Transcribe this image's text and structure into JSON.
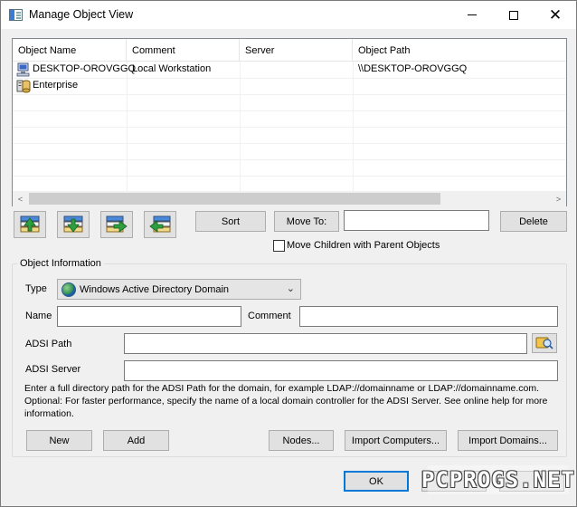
{
  "window": {
    "title": "Manage Object View",
    "minimize_icon": "minimize-icon",
    "maximize_icon": "maximize-icon",
    "close_icon": "close-icon",
    "close_glyph": "✕"
  },
  "list": {
    "columns": [
      "Object Name",
      "Comment",
      "Server",
      "Object Path"
    ],
    "rows": [
      {
        "icon": "workstation-icon",
        "name": "DESKTOP-OROVGGQ",
        "comment": "Local Workstation",
        "server": "",
        "path": "\\\\DESKTOP-OROVGGQ"
      },
      {
        "icon": "enterprise-icon",
        "name": "Enterprise",
        "comment": "",
        "server": "",
        "path": ""
      }
    ],
    "scroll_left_glyph": "<",
    "scroll_right_glyph": ">"
  },
  "toolbar": {
    "move_up_icon": "move-up-icon",
    "move_down_icon": "move-down-icon",
    "move_right_icon": "move-right-icon",
    "move_left_icon": "move-left-icon",
    "sort_label": "Sort",
    "move_to_label": "Move To:",
    "move_to_value": "",
    "delete_label": "Delete",
    "move_children_label": "Move Children with Parent Objects",
    "move_children_checked": false
  },
  "object_info": {
    "group_title": "Object Information",
    "type_label": "Type",
    "type_value": "Windows Active Directory Domain",
    "type_icon": "globe-icon",
    "chevron": "⌄",
    "name_label": "Name",
    "name_value": "",
    "comment_label": "Comment",
    "comment_value": "",
    "adsi_path_label": "ADSI Path",
    "adsi_path_value": "",
    "adsi_server_label": "ADSI Server",
    "adsi_server_value": "",
    "help_text": "Enter a full directory path for the ADSI Path for the domain, for example LDAP://domainname or LDAP://domainname.com.  Optional: For faster performance, specify the name of a local domain controller for the ADSI Server.  See online help for more  information.",
    "new_label": "New",
    "add_label": "Add",
    "nodes_label": "Nodes...",
    "import_computers_label": "Import Computers...",
    "import_domains_label": "Import Domains..."
  },
  "footer": {
    "ok_label": "OK",
    "watermark": "PCPROGS.NET"
  },
  "colors": {
    "accent": "#0078d7",
    "button_face": "#e1e1e1",
    "dialog_bg": "#f0f0f0",
    "arrow_green": "#2e9e3e"
  }
}
